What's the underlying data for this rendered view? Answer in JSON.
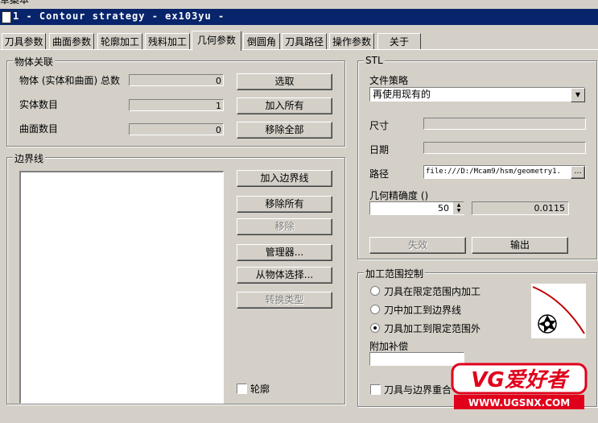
{
  "window": {
    "title": "1 - Contour strategy - ex103yu -",
    "cut_text": "草案本"
  },
  "tabs": [
    {
      "label": "刀具参数"
    },
    {
      "label": "曲面参数"
    },
    {
      "label": "轮廓加工"
    },
    {
      "label": "残料加工"
    },
    {
      "label": "几何参数"
    },
    {
      "label": "倒圆角"
    },
    {
      "label": "刀具路径"
    },
    {
      "label": "操作参数"
    },
    {
      "label": "关于"
    }
  ],
  "active_tab": "几何参数",
  "objects": {
    "legend": "物体关联",
    "total_label": "物体 (实体和曲面) 总数",
    "total_value": "0",
    "solids_label": "实体数目",
    "solids_value": "1",
    "surfaces_label": "曲面数目",
    "surfaces_value": "0",
    "select_button": "选取",
    "add_all_button": "加入所有",
    "remove_all_button": "移除全部"
  },
  "boundary": {
    "legend": "边界线",
    "add_button": "加入边界线",
    "remove_all_button": "移除所有",
    "remove_button": "移除",
    "manager_button": "管理器...",
    "from_object_button": "从物体选择...",
    "convert_button": "转换类型",
    "contour_checkbox": "轮廓",
    "contour_checked": false
  },
  "stl": {
    "legend": "STL",
    "policy_label": "文件策略",
    "policy_value": "再使用现有的",
    "size_label": "尺寸",
    "size_value": "",
    "date_label": "日期",
    "date_value": "",
    "path_label": "路径",
    "path_value": "file:///D:/Mcam9/hsm/geometry1.",
    "path_button": "...",
    "tolerance_label": "几何精确度 ()",
    "tolerance_value": "50",
    "tolerance_result": "0.0115",
    "invalidate_button": "失效",
    "export_button": "输出"
  },
  "range": {
    "legend": "加工范围控制",
    "options": [
      {
        "label": "刀具在限定范围内加工",
        "selected": false
      },
      {
        "label": "刀中加工到边界线",
        "selected": false
      },
      {
        "label": "刀具加工到限定范围外",
        "selected": true
      }
    ],
    "offset_label": "附加补偿",
    "offset_value": "",
    "coincide_checkbox": "刀具与边界重合",
    "coincide_checked": false
  },
  "watermark": {
    "logo_text": "VG爱好者",
    "url": "WWW.UGSNX.COM",
    "color": "#e0001b"
  }
}
